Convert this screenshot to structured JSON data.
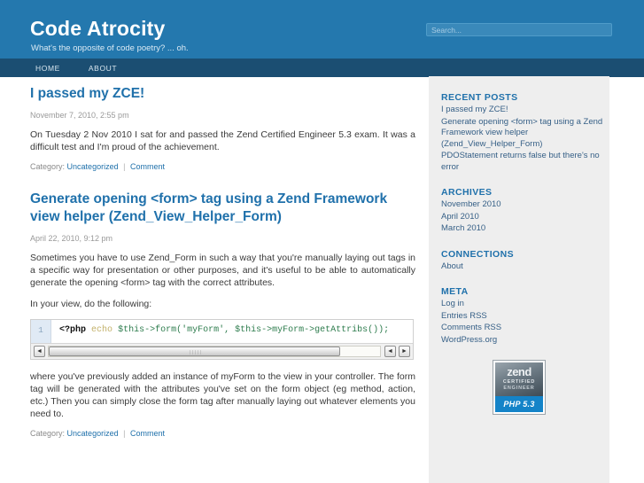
{
  "header": {
    "site_title": "Code Atrocity",
    "tagline": "What's the opposite of code poetry? ... oh.",
    "search_placeholder": "Search...",
    "search_value": "",
    "bg_color": "#2478ae"
  },
  "nav": {
    "items": [
      {
        "label": "HOME"
      },
      {
        "label": "ABOUT"
      }
    ],
    "bg_color": "#1b4e72"
  },
  "posts": [
    {
      "title": "I passed my ZCE!",
      "date": "November 7, 2010, 2:55 pm",
      "paragraphs": [
        "On Tuesday 2 Nov 2010 I sat for and passed the Zend Certified Engineer 5.3 exam.  It was a difficult test and I'm proud of the achievement."
      ],
      "meta_label": "Category:",
      "category": "Uncategorized",
      "comment": "Comment"
    },
    {
      "title": "Generate opening <form> tag using a Zend Framework view helper (Zend_View_Helper_Form)",
      "date": "April 22, 2010, 9:12 pm",
      "paragraph_1": "Sometimes you have to use Zend_Form in such a way that you're manually laying out tags in a specific way for presentation or other purposes, and it's useful to be able to automatically generate the opening <form> tag with the correct attributes.",
      "paragraph_2": "In your view, do the following:",
      "paragraph_3": "where you've previously added an instance of myForm to the view in your controller. The form tag will be generated with the attributes you've set on the form object (eg method, action, etc.) Then you can simply close the form tag after manually laying out whatever elements you need to.",
      "meta_label": "Category:",
      "category": "Uncategorized",
      "comment": "Comment",
      "code": {
        "line_number": "1",
        "tokens": {
          "open_tag": "<?php",
          "keyword": "echo",
          "rest": "$this->form('myForm', $this->myForm->getAttribs());"
        },
        "scroll_left_icon": "◄",
        "scroll_right_icon": "►"
      }
    }
  ],
  "sidebar": {
    "widgets": [
      {
        "title": "Recent Posts",
        "items": [
          {
            "label": "I passed my ZCE!"
          },
          {
            "label": "Generate opening <form> tag using a Zend Framework view helper (Zend_View_Helper_Form)"
          },
          {
            "label": "PDOStatement returns false but there's no error"
          }
        ]
      },
      {
        "title": "Archives",
        "items": [
          {
            "label": "November 2010"
          },
          {
            "label": "April 2010"
          },
          {
            "label": "March 2010"
          }
        ]
      },
      {
        "title": "Connections",
        "items": [
          {
            "label": "About"
          }
        ]
      },
      {
        "title": "Meta",
        "items": [
          {
            "label": "Log in"
          },
          {
            "label": "Entries RSS"
          },
          {
            "label": "Comments RSS"
          },
          {
            "label": "WordPress.org"
          }
        ]
      }
    ],
    "badge": {
      "brand": "zend",
      "line1": "CERTIFIED",
      "line2": "ENGINEER",
      "version": "PHP 5.3",
      "accent_color": "#1483c8"
    }
  }
}
